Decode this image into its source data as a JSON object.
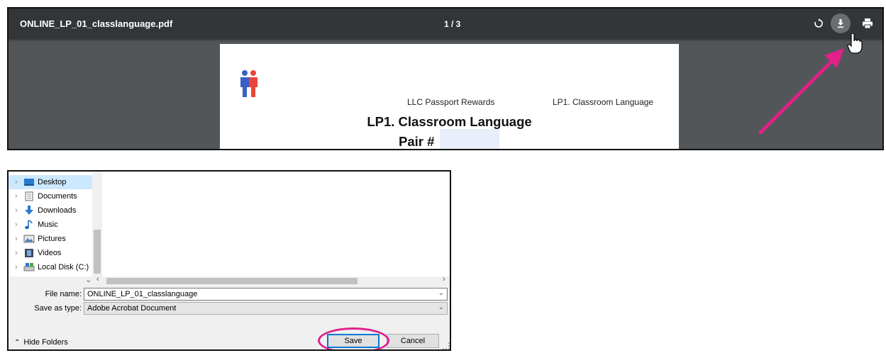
{
  "viewer": {
    "filename": "ONLINE_LP_01_classlanguage.pdf",
    "page_indicator": "1 / 3",
    "icons": [
      "rotate-icon",
      "download-icon",
      "print-icon"
    ],
    "document": {
      "header_center": "LLC Passport Rewards",
      "header_right": "LP1. Classroom Language",
      "title": "LP1. Classroom Language",
      "pair_label": "Pair #"
    },
    "annotation_color": "#e0218a"
  },
  "dialog": {
    "folders": [
      {
        "label": "Desktop",
        "icon": "desktop-icon",
        "selected": true
      },
      {
        "label": "Documents",
        "icon": "documents-icon",
        "selected": false
      },
      {
        "label": "Downloads",
        "icon": "downloads-icon",
        "selected": false
      },
      {
        "label": "Music",
        "icon": "music-icon",
        "selected": false
      },
      {
        "label": "Pictures",
        "icon": "pictures-icon",
        "selected": false
      },
      {
        "label": "Videos",
        "icon": "videos-icon",
        "selected": false
      },
      {
        "label": "Local Disk (C:)",
        "icon": "local-disk-icon",
        "selected": false
      }
    ],
    "file_name_label": "File name:",
    "file_name_value": "ONLINE_LP_01_classlanguage",
    "save_type_label": "Save as type:",
    "save_type_value": "Adobe Acrobat Document",
    "hide_folders": "Hide Folders",
    "save_button": "Save",
    "cancel_button": "Cancel"
  }
}
